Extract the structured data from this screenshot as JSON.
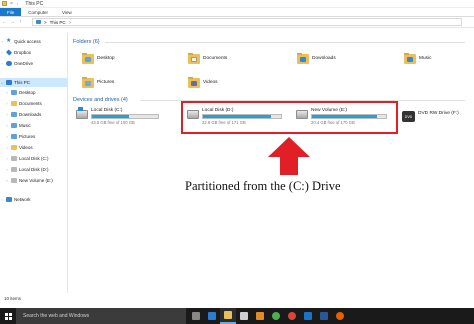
{
  "window": {
    "title": "This PC",
    "quick_access_sep": "=",
    "quick_access_chev": "↓"
  },
  "ribbon": {
    "tabs": [
      "File",
      "Computer",
      "View"
    ]
  },
  "address": {
    "back": "←",
    "forward": "→",
    "up": "↑",
    "separator": ">",
    "location": "This PC",
    "chevron": ">"
  },
  "sidebar": {
    "items": [
      {
        "label": "Quick access",
        "icon": "star-icon"
      },
      {
        "label": "Dropbox",
        "icon": "dropbox-icon"
      },
      {
        "label": "OneDrive",
        "icon": "onedrive-icon"
      },
      {
        "label": "This PC",
        "icon": "pc-icon"
      },
      {
        "label": "Desktop",
        "icon": "folder-blue-icon"
      },
      {
        "label": "Documents",
        "icon": "folder-icon"
      },
      {
        "label": "Downloads",
        "icon": "download-icon"
      },
      {
        "label": "Music",
        "icon": "music-icon"
      },
      {
        "label": "Pictures",
        "icon": "pictures-icon"
      },
      {
        "label": "Videos",
        "icon": "videos-icon"
      },
      {
        "label": "Local Disk (C:)",
        "icon": "drive-icon"
      },
      {
        "label": "Local Disk (D:)",
        "icon": "drive-icon"
      },
      {
        "label": "New Volume (E:)",
        "icon": "drive-icon"
      },
      {
        "label": "Network",
        "icon": "network-icon"
      }
    ]
  },
  "folders": {
    "heading": "Folders (6)",
    "items": [
      {
        "label": "Desktop",
        "color": "#5ea1dd"
      },
      {
        "label": "Documents",
        "color": "#8a8a8a"
      },
      {
        "label": "Downloads",
        "color": "#3a86cf"
      },
      {
        "label": "Music",
        "color": "#3a86cf"
      },
      {
        "label": "Pictures",
        "color": "#7aa7d8"
      },
      {
        "label": "Videos",
        "color": "#6c6c9a"
      }
    ]
  },
  "drives": {
    "heading": "Devices and drives (4)",
    "items": [
      {
        "name": "Local Disk (C:)",
        "free": "43.5 GB free of 100 GB",
        "used_fraction": 0.565
      },
      {
        "name": "Local Disk (D:)",
        "free": "22.6 GB free of 171 GB",
        "used_fraction": 0.868
      },
      {
        "name": "New Volume (E:)",
        "free": "20.4 GB free of 170 GB",
        "used_fraction": 0.88
      },
      {
        "name": "DVD RW Drive (F:)",
        "free": "",
        "dvd_label": "DVD"
      }
    ]
  },
  "annotation": {
    "caption": "Partitioned from the (C:) Drive",
    "highlight_color": "#e01f26"
  },
  "status": {
    "count": "10 items"
  },
  "taskbar": {
    "search_placeholder": "Search the web and Windows",
    "icons": [
      {
        "name": "task-view-icon",
        "color": "#888888"
      },
      {
        "name": "edge-icon",
        "color": "#2c7cd1"
      },
      {
        "name": "file-explorer-icon",
        "color": "#e8c15a"
      },
      {
        "name": "store-icon",
        "color": "#cfcfcf"
      },
      {
        "name": "media-player-icon",
        "color": "#e48a2a"
      },
      {
        "name": "chrome-icon",
        "color": "#4caf50"
      },
      {
        "name": "chrome-alt-icon",
        "color": "#d8453a"
      },
      {
        "name": "outlook-icon",
        "color": "#1a73c9"
      },
      {
        "name": "word-icon",
        "color": "#2b5797"
      },
      {
        "name": "firefox-icon",
        "color": "#e66000"
      }
    ]
  }
}
